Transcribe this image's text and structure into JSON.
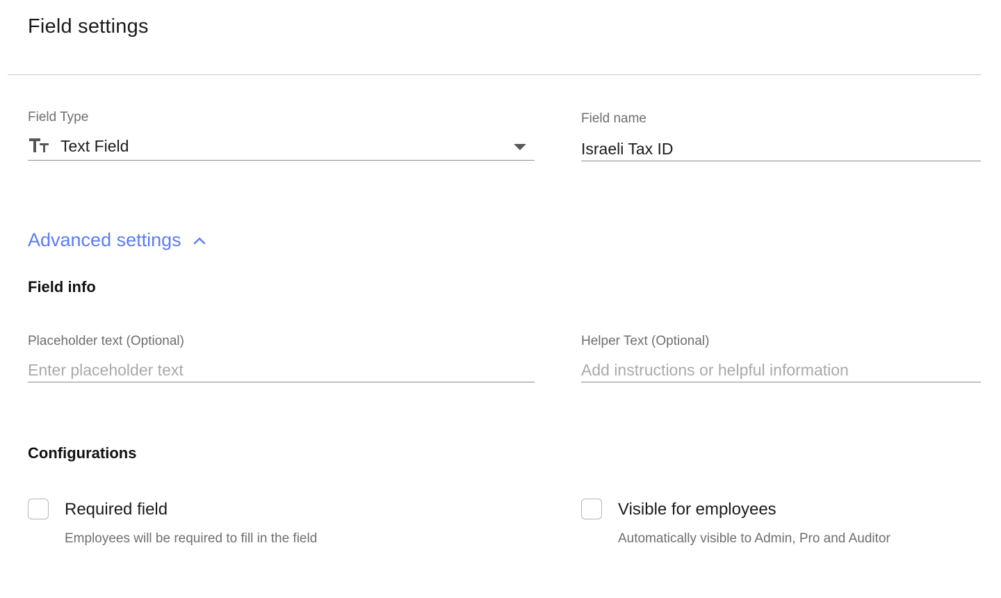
{
  "header": {
    "title": "Field settings"
  },
  "field_type": {
    "label": "Field Type",
    "value": "Text Field",
    "icon": "text-type-icon"
  },
  "field_name": {
    "label": "Field name",
    "value": "Israeli Tax ID"
  },
  "advanced": {
    "label": "Advanced settings",
    "icon": "chevron-up-icon",
    "color": "#5b7cf5"
  },
  "field_info": {
    "heading": "Field info",
    "placeholder_field": {
      "label": "Placeholder text (Optional)",
      "placeholder": "Enter placeholder text",
      "value": ""
    },
    "helper_field": {
      "label": "Helper Text (Optional)",
      "placeholder": "Add instructions or helpful information",
      "value": ""
    }
  },
  "configurations": {
    "heading": "Configurations",
    "required": {
      "label": "Required field",
      "description": "Employees will be required to fill in the field",
      "checked": false
    },
    "visible": {
      "label": "Visible for employees",
      "description": "Automatically visible to Admin, Pro and Auditor",
      "checked": false
    }
  }
}
